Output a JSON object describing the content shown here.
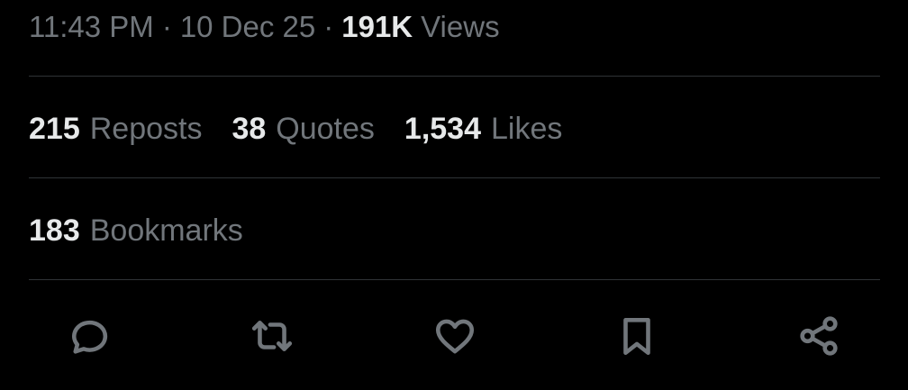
{
  "meta": {
    "time": "11:43 PM",
    "separator": "·",
    "date": "10 Dec 25",
    "views_count": "191K",
    "views_label": "Views"
  },
  "stats": {
    "reposts": {
      "count": "215",
      "label": "Reposts"
    },
    "quotes": {
      "count": "38",
      "label": "Quotes"
    },
    "likes": {
      "count": "1,534",
      "label": "Likes"
    },
    "bookmarks": {
      "count": "183",
      "label": "Bookmarks"
    }
  },
  "actions": [
    {
      "name": "reply",
      "icon": "comment-icon"
    },
    {
      "name": "repost",
      "icon": "repost-icon"
    },
    {
      "name": "like",
      "icon": "heart-icon"
    },
    {
      "name": "bookmark",
      "icon": "bookmark-icon"
    },
    {
      "name": "share",
      "icon": "share-icon"
    }
  ],
  "colors": {
    "background": "#000000",
    "primary_text": "#e7e9ea",
    "secondary_text": "#71767b",
    "divider": "#2f3336"
  }
}
